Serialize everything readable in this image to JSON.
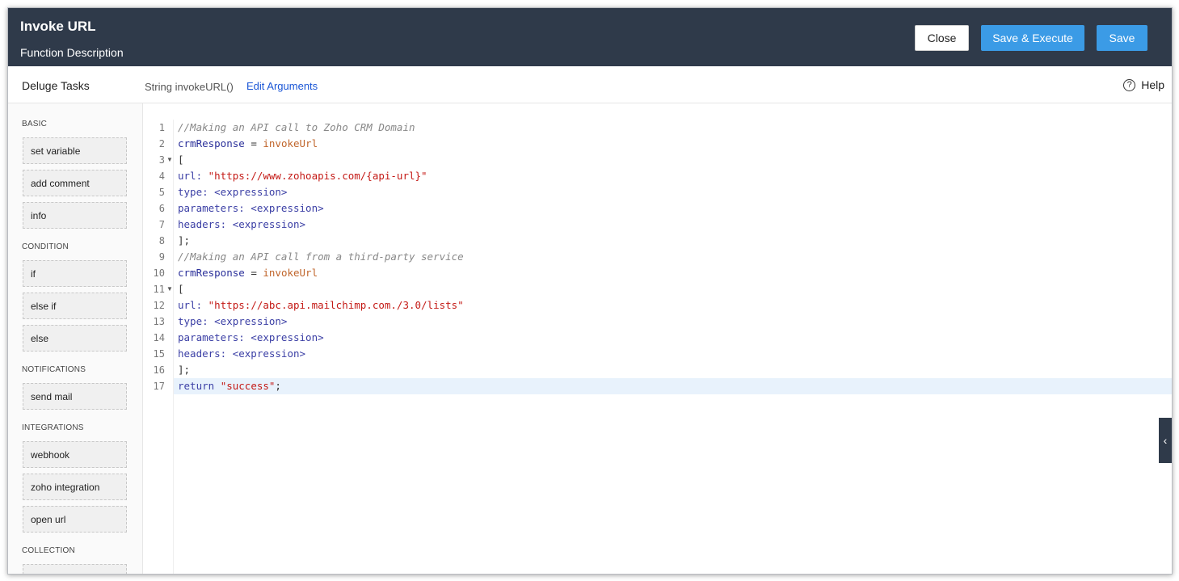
{
  "header": {
    "title": "Invoke URL",
    "subtitle": "Function Description",
    "close_label": "Close",
    "save_execute_label": "Save & Execute",
    "save_label": "Save"
  },
  "toolbar": {
    "deluge_tasks": "Deluge Tasks",
    "signature": "String invokeURL()",
    "edit_arguments": "Edit Arguments",
    "help": "Help",
    "help_icon_glyph": "?"
  },
  "sidebar": {
    "basic": "BASIC",
    "basic_items": [
      "set variable",
      "add comment",
      "info"
    ],
    "condition": "CONDITION",
    "condition_items": [
      "if",
      "else if",
      "else"
    ],
    "notifications": "NOTIFICATIONS",
    "notification_items": [
      "send mail"
    ],
    "integrations": "INTEGRATIONS",
    "integration_items": [
      "webhook",
      "zoho integration",
      "open url"
    ],
    "collection": "COLLECTION"
  },
  "editor": {
    "line_numbers": [
      "1",
      "2",
      "3",
      "4",
      "5",
      "6",
      "7",
      "8",
      "9",
      "10",
      "11",
      "12",
      "13",
      "14",
      "15",
      "16",
      "17"
    ],
    "lines": {
      "l1": "//Making an API call to Zoho CRM Domain",
      "l2_var": "crmResponse",
      "l2_eq": " = ",
      "l2_fn": "invokeUrl",
      "l3": "[",
      "l4_key": "url: ",
      "l4_str": "\"https://www.zohoapis.com/{api-url}\"",
      "l5": "type: <expression>",
      "l6": "parameters: <expression>",
      "l7": "headers: <expression>",
      "l8": "];",
      "l9": "//Making an API call from a third-party service",
      "l10_var": "crmResponse",
      "l10_eq": " = ",
      "l10_fn": "invokeUrl",
      "l11": "[",
      "l12_key": "url: ",
      "l12_str": "\"https://abc.api.mailchimp.com./3.0/lists\"",
      "l13": "type: <expression>",
      "l14": "parameters: <expression>",
      "l15": "headers: <expression>",
      "l16": "];",
      "l17_kw": "return ",
      "l17_str": "\"success\"",
      "l17_end": ";"
    },
    "fold_glyph": "▼",
    "collapse_glyph": "‹"
  }
}
